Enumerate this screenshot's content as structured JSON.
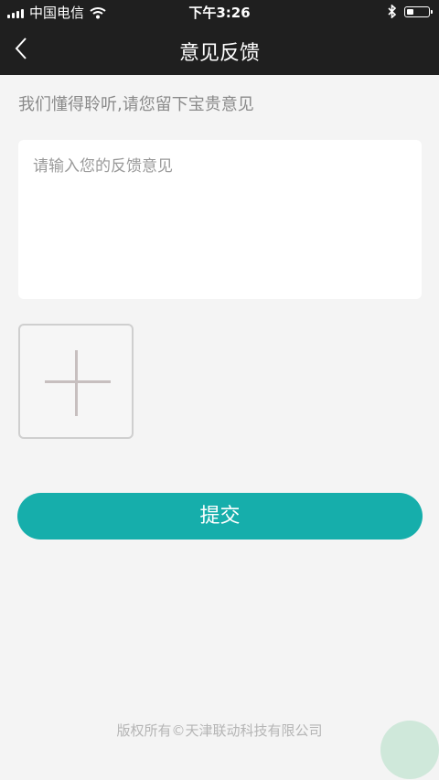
{
  "status_bar": {
    "carrier": "中国电信",
    "time": "下午3:26",
    "signal_icon": "signal-icon",
    "wifi_icon": "wifi-icon",
    "bluetooth_icon": "bluetooth-icon",
    "battery_icon": "battery-icon",
    "battery_level": 0.35
  },
  "nav": {
    "title": "意见反馈",
    "back_icon": "chevron-left-icon"
  },
  "main": {
    "subtitle": "我们懂得聆听,请您留下宝贵意见",
    "feedback_placeholder": "请输入您的反馈意见",
    "feedback_value": "",
    "add_image_icon": "plus-icon",
    "submit_label": "提交"
  },
  "footer": {
    "copyright": "版权所有©天津联动科技有限公司"
  },
  "colors": {
    "header_bg": "#1f1f1f",
    "page_bg": "#f4f4f4",
    "accent": "#16aeab",
    "float_button": "#cfe8da"
  }
}
